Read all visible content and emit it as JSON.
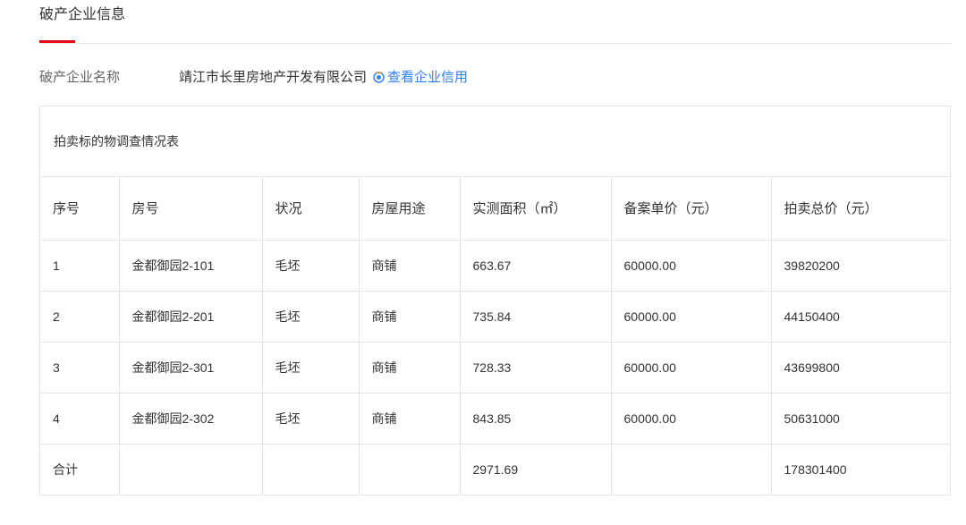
{
  "section": {
    "title": "破产企业信息"
  },
  "company": {
    "label": "破产企业名称",
    "name": "靖江市长里房地产开发有限公司",
    "credit_link": "查看企业信用",
    "credit_icon": "credit-badge-icon",
    "link_color": "#2d7ff9",
    "accent_color": "#e60012"
  },
  "table": {
    "caption": "拍卖标的物调查情况表",
    "headers": [
      "序号",
      "房号",
      "状况",
      "房屋用途",
      "实测面积（㎡）",
      "备案单价（元）",
      "拍卖总价（元）"
    ],
    "rows": [
      [
        "1",
        "金都御园2-101",
        "毛坯",
        "商铺",
        "663.67",
        "60000.00",
        "39820200"
      ],
      [
        "2",
        "金都御园2-201",
        "毛坯",
        "商铺",
        "735.84",
        "60000.00",
        "44150400"
      ],
      [
        "3",
        "金都御园2-301",
        "毛坯",
        "商铺",
        "728.33",
        "60000.00",
        "43699800"
      ],
      [
        "4",
        "金都御园2-302",
        "毛坯",
        "商铺",
        "843.85",
        "60000.00",
        "50631000"
      ],
      [
        "合计",
        "",
        "",
        "",
        "2971.69",
        "",
        "178301400"
      ]
    ]
  }
}
